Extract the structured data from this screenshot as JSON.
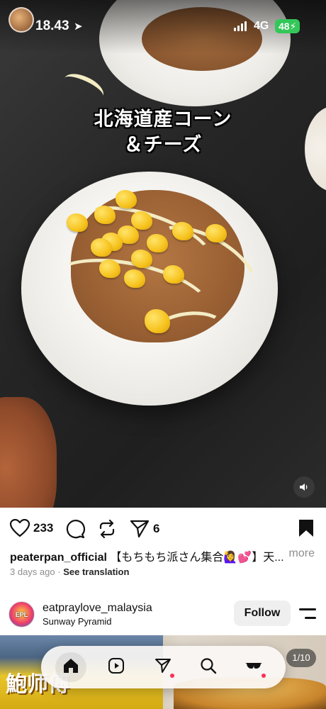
{
  "status_bar": {
    "time": "18.43",
    "network": "4G",
    "battery": "48"
  },
  "media": {
    "caption_line1": "北海道産コーン",
    "caption_line2": "＆チーズ"
  },
  "actions": {
    "likes": "233",
    "shares": "6"
  },
  "post": {
    "username": "peaterpan_official",
    "caption_text": "【もちもち派さん集合🙋‍♀️💕】天...",
    "more_label": "more",
    "age": "3 days ago",
    "separator": "·",
    "translate_label": "See translation"
  },
  "next_post": {
    "username": "eatpraylove_malaysia",
    "location": "Sunway Pyramid",
    "follow_label": "Follow",
    "image_counter": "1/10",
    "sign_text": "鮑师傅"
  },
  "bottom_nav": {
    "items": [
      "home-icon",
      "reels-icon",
      "direct-icon",
      "search-icon",
      "profile-icon"
    ],
    "notification_dot_color": "#ff2e55"
  },
  "colors": {
    "text": "#111111",
    "secondary": "#8e8e8e",
    "follow_bg": "#efefef",
    "battery": "#33c759"
  }
}
